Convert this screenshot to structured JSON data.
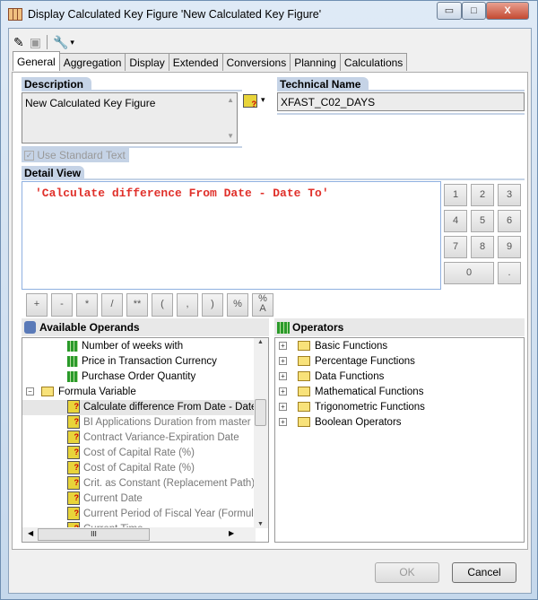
{
  "window": {
    "title": "Display Calculated Key Figure 'New Calculated Key Figure'",
    "minimize": "▭",
    "maximize": "□",
    "close": "X"
  },
  "toolbar": {
    "edit_icon": "pencil-icon",
    "save_icon": "save-icon",
    "tools_icon": "tools-icon",
    "dropdown": "▾"
  },
  "tabs": [
    "General",
    "Aggregation",
    "Display",
    "Extended",
    "Conversions",
    "Planning",
    "Calculations"
  ],
  "description": {
    "label": "Description",
    "value": "New Calculated Key Figure"
  },
  "technical_name": {
    "label": "Technical Name",
    "value": "XFAST_C02_DAYS"
  },
  "use_standard_text": {
    "label": "Use Standard Text",
    "checked": true
  },
  "detail_view": {
    "label": "Detail View",
    "formula": "'Calculate difference From Date - Date To'"
  },
  "numpad": [
    "1",
    "2",
    "3",
    "4",
    "5",
    "6",
    "7",
    "8",
    "9",
    "0",
    "."
  ],
  "operator_buttons": [
    "+",
    "-",
    "*",
    "/",
    "**",
    "(",
    ",",
    ")",
    "%",
    "%\nA"
  ],
  "operands": {
    "label": "Available Operands",
    "items": [
      {
        "label": "Number of weeks with",
        "type": "keyfigure"
      },
      {
        "label": "Price in Transaction Currency",
        "type": "keyfigure"
      },
      {
        "label": "Purchase Order Quantity",
        "type": "keyfigure"
      },
      {
        "label": "Formula Variable",
        "type": "folder"
      },
      {
        "label": "Calculate difference From Date - Date",
        "type": "variable",
        "selected": true
      },
      {
        "label": "BI Applications Duration from master d",
        "type": "variable"
      },
      {
        "label": "Contract Variance-Expiration Date",
        "type": "variable"
      },
      {
        "label": "Cost of Capital Rate (%)",
        "type": "variable"
      },
      {
        "label": "Cost of Capital Rate (%)",
        "type": "variable"
      },
      {
        "label": "Crit. as Constant (Replacement Path)",
        "type": "variable"
      },
      {
        "label": "Current Date",
        "type": "variable"
      },
      {
        "label": "Current Period of Fiscal Year (Formula",
        "type": "variable"
      },
      {
        "label": "Current Time",
        "type": "variable"
      }
    ],
    "hscroll_grip": "III"
  },
  "operators": {
    "label": "Operators",
    "items": [
      "Basic Functions",
      "Percentage Functions",
      "Data Functions",
      "Mathematical Functions",
      "Trigonometric Functions",
      "Boolean Operators"
    ]
  },
  "buttons": {
    "ok": "OK",
    "cancel": "Cancel"
  }
}
